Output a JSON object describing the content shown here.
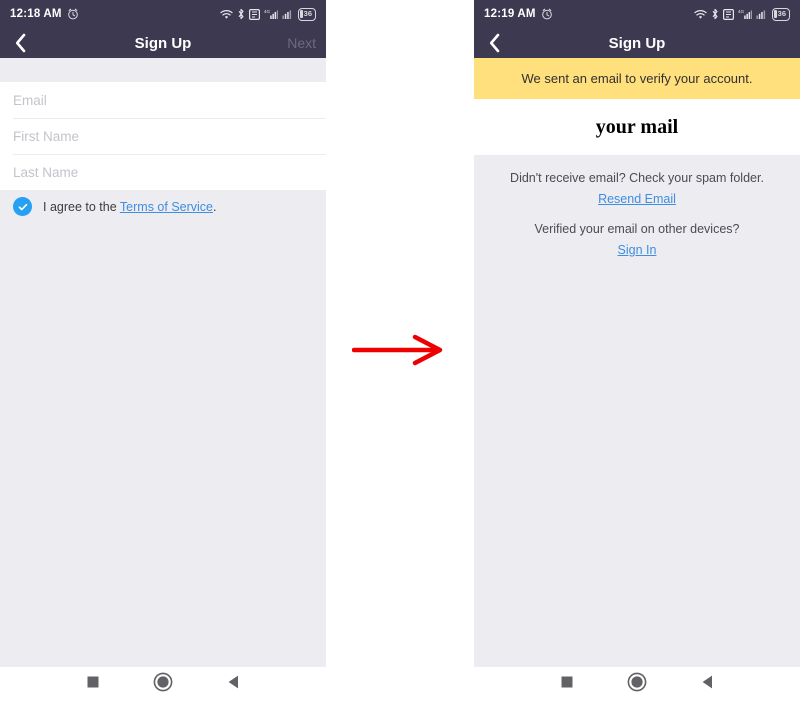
{
  "colors": {
    "header_bg": "#3c3950",
    "banner_bg": "#ffe07d",
    "accent_blue": "#25a0f3",
    "link_blue": "#3f8ee0",
    "page_bg": "#ececf1",
    "arrow_red": "#ee0000"
  },
  "left_phone": {
    "status_bar": {
      "time": "12:18 AM",
      "icons": [
        "alarm-icon",
        "wifi-icon",
        "bluetooth-icon",
        "screenshot-icon",
        "signal-4g-icon",
        "signal-icon"
      ],
      "battery_level": "36"
    },
    "header": {
      "back_label": "Back",
      "title": "Sign Up",
      "action_label": "Next"
    },
    "form": {
      "fields": [
        {
          "name": "email",
          "placeholder": "Email",
          "value": ""
        },
        {
          "name": "first-name",
          "placeholder": "First Name",
          "value": ""
        },
        {
          "name": "last-name",
          "placeholder": "Last Name",
          "value": ""
        }
      ],
      "terms": {
        "checked": true,
        "prefix": "I agree to the ",
        "link": "Terms of Service",
        "suffix": "."
      }
    }
  },
  "right_phone": {
    "status_bar": {
      "time": "12:19 AM",
      "battery_level": "36"
    },
    "header": {
      "back_label": "Back",
      "title": "Sign Up"
    },
    "banner": {
      "text": "We sent an email to verify your account."
    },
    "mail": {
      "title": "your mail"
    },
    "info": {
      "spam_text": "Didn't receive email? Check your spam folder.",
      "resend_link": "Resend Email",
      "verified_text": "Verified your email on other devices?",
      "signin_link": "Sign In"
    }
  },
  "nav_bar": {
    "recents_label": "Recents",
    "home_label": "Home",
    "back_label": "Back"
  },
  "annotation": {
    "arrow_name": "transition-arrow"
  }
}
